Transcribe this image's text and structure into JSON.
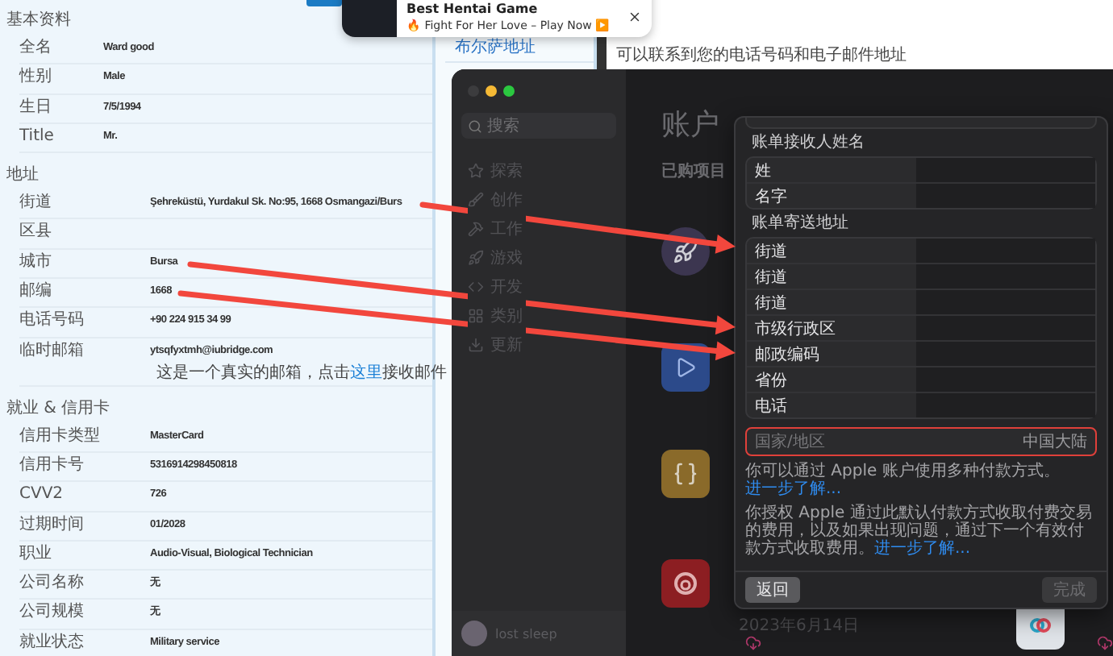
{
  "sections": [
    {
      "title": "基本资料",
      "rows": [
        {
          "label": "全名",
          "value": "Ward good"
        },
        {
          "label": "性别",
          "value": "Male"
        },
        {
          "label": "生日",
          "value": "7/5/1994"
        },
        {
          "label": "Title",
          "value": "Mr."
        }
      ]
    },
    {
      "title": "地址",
      "rows": [
        {
          "label": "街道",
          "value": "Şehreküstü, Yurdakul Sk. No:95, 1668 Osmangazi/Burs"
        },
        {
          "label": "区县",
          "value": ""
        },
        {
          "label": "城市",
          "value": "Bursa"
        },
        {
          "label": "邮编",
          "value": "1668"
        },
        {
          "label": "电话号码",
          "value": "+90 224 915 34 99"
        },
        {
          "label": "临时邮箱",
          "value": "ytsqfyxtmh@iubridge.com",
          "note": {
            "before": "这是一个真实的邮箱，点击",
            "link": "这里",
            "after": "接收邮件"
          }
        }
      ]
    },
    {
      "title": "就业 & 信用卡",
      "rows": [
        {
          "label": "信用卡类型",
          "value": "MasterCard"
        },
        {
          "label": "信用卡号",
          "value": "5316914298450818"
        },
        {
          "label": "CVV2",
          "value": "726"
        },
        {
          "label": "过期时间",
          "value": "01/2028"
        },
        {
          "label": "职业",
          "value": "Audio-Visual, Biological Technician"
        },
        {
          "label": "公司名称",
          "value": "无"
        },
        {
          "label": "公司规模",
          "value": "无"
        },
        {
          "label": "就业状态",
          "value": "Military service"
        }
      ]
    }
  ],
  "side_links": [
    "布尔萨地址"
  ],
  "background_text": "可以联系到您的电话号码和电子邮件地址",
  "notification": {
    "title": "Best Hentai Game",
    "message": "🔥 Fight For Her Love – Play Now ▶️"
  },
  "app_window": {
    "search": {
      "placeholder": "搜索"
    },
    "nav": [
      "探索",
      "创作",
      "工作",
      "游戏",
      "开发",
      "类别",
      "更新"
    ],
    "user": "lost sleep",
    "title": "账户",
    "subtitle": "已购项目",
    "date": "2023年6月14日"
  },
  "sheet": {
    "name_section": {
      "title": "账单接收人姓名",
      "fields": [
        "姓",
        "名字"
      ]
    },
    "address_section": {
      "title": "账单寄送地址",
      "fields": [
        "街道",
        "街道",
        "街道",
        "市级行政区",
        "邮政编码",
        "省份",
        "电话"
      ]
    },
    "country": {
      "label": "国家/地区",
      "value": "中国大陆",
      "highlighted": true
    },
    "notes": [
      {
        "text": "你可以通过 Apple 账户使用多种付款方式。",
        "link": "进一步了解..."
      },
      {
        "text": "你授权 Apple 通过此默认付款方式收取付费交易的费用，以及如果出现问题，通过下一个有效付款方式收取费用。",
        "link": "进一步了解..."
      }
    ],
    "buttons": [
      {
        "label": "返回",
        "disabled": false
      },
      {
        "label": "完成",
        "disabled": true
      }
    ]
  }
}
